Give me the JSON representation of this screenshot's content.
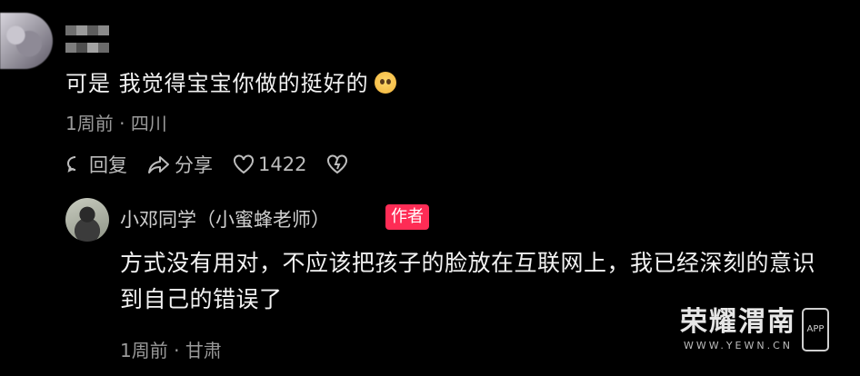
{
  "comment": {
    "text": "可是 我觉得宝宝你做的挺好的",
    "emoji": "pleading-face",
    "time": "1周前",
    "location": "四川",
    "actions": {
      "reply": "回复",
      "share": "分享",
      "likes": "1422"
    }
  },
  "reply": {
    "username": "小邓同学（小蜜蜂老师）",
    "badge": "作者",
    "text": "方式没有用对，不应该把孩子的脸放在互联网上，我已经深刻的意识到自己的错误了",
    "time": "1周前",
    "location": "甘肃"
  },
  "watermark": {
    "title": "荣耀渭南",
    "url": "WWW.YEWN.CN",
    "app": "APP"
  },
  "colors": {
    "background": "#000000",
    "badge": "#fe2c55",
    "meta": "#9a9a9a"
  }
}
